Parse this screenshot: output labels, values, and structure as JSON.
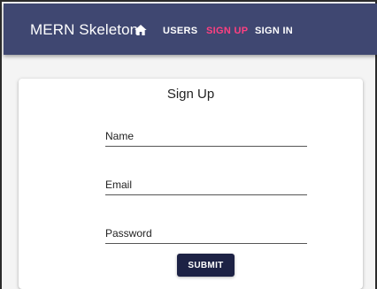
{
  "appbar": {
    "title": "MERN Skeleton",
    "home_icon": "home-icon",
    "nav": {
      "users": "USERS",
      "signup": "SIGN UP",
      "signin": "SIGN IN"
    },
    "colors": {
      "bar": "#3f4771",
      "active": "#ff4081"
    }
  },
  "form": {
    "title": "Sign Up",
    "fields": {
      "name_label": "Name",
      "email_label": "Email",
      "password_label": "Password"
    },
    "submit_label": "SUBMIT",
    "colors": {
      "submit_bg": "#1d2245"
    }
  }
}
